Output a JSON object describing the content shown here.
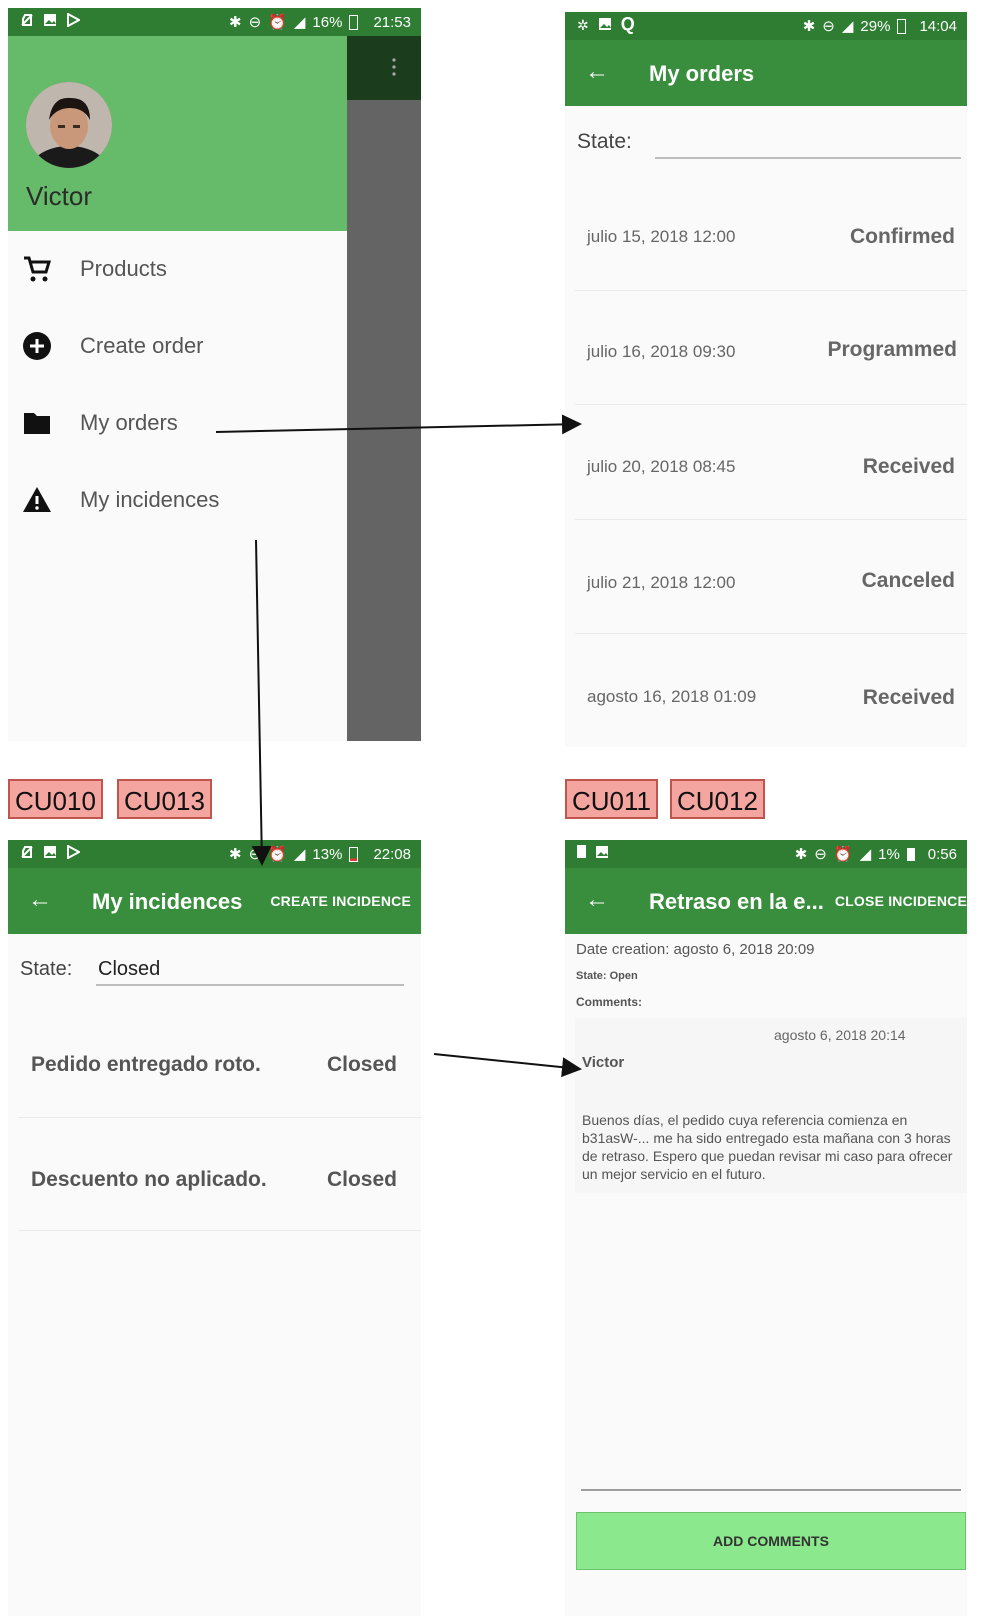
{
  "screens": {
    "drawer": {
      "status": {
        "pct": "16%",
        "time": "21:53"
      },
      "user_name": "Victor",
      "menu": [
        {
          "label": "Products",
          "icon": "cart-icon"
        },
        {
          "label": "Create order",
          "icon": "add-circle-icon"
        },
        {
          "label": "My orders",
          "icon": "folder-icon"
        },
        {
          "label": "My incidences",
          "icon": "warning-icon"
        }
      ]
    },
    "orders": {
      "status": {
        "pct": "29%",
        "time": "14:04"
      },
      "title": "My orders",
      "state_label": "State:",
      "rows": [
        {
          "date": "julio 15, 2018 12:00",
          "state": "Confirmed"
        },
        {
          "date": "julio 16, 2018 09:30",
          "state": "Programmed"
        },
        {
          "date": "julio 20, 2018 08:45",
          "state": "Received"
        },
        {
          "date": "julio 21, 2018 12:00",
          "state": "Canceled"
        },
        {
          "date": "agosto 16, 2018 01:09",
          "state": "Received"
        }
      ]
    },
    "incidences": {
      "status": {
        "pct": "13%",
        "time": "22:08"
      },
      "title": "My incidences",
      "action": "CREATE INCIDENCE",
      "state_label": "State:",
      "state_value": "Closed",
      "rows": [
        {
          "title": "Pedido entregado roto.",
          "state": "Closed"
        },
        {
          "title": "Descuento no aplicado.",
          "state": "Closed"
        }
      ]
    },
    "detail": {
      "status": {
        "pct": "1%",
        "time": "0:56"
      },
      "title": "Retraso en la e...",
      "action": "CLOSE INCIDENCE",
      "date_creation": "Date creation: agosto 6, 2018 20:09",
      "state": "State: Open",
      "comments_label": "Comments:",
      "comment": {
        "date": "agosto 6, 2018 20:14",
        "author": "Victor",
        "text": "Buenos días, el pedido cuya referencia comienza en b31asW-... me ha sido entregado esta mañana con 3 horas de retraso. Espero que puedan revisar mi caso para ofrecer un mejor servicio en el futuro."
      },
      "add_button": "ADD COMMENTS"
    }
  },
  "tags": [
    "CU010",
    "CU013",
    "CU011",
    "CU012"
  ],
  "colors": {
    "appbar": "#388e3c",
    "statusbar": "#2e7d32",
    "header": "#66bb6a",
    "button": "#8ce88c",
    "tag": "#f4a5a0"
  }
}
